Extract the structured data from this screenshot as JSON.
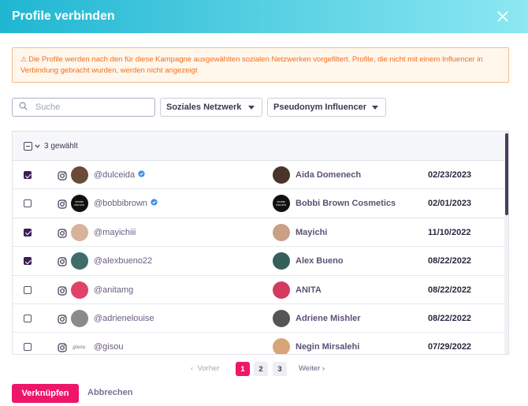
{
  "dialog": {
    "title": "Profile verbinden",
    "close_icon": "close-icon"
  },
  "alert": {
    "icon": "warning-icon",
    "text": "Die Profile werden nach den für diese Kampagne ausgewählten sozialen Netzwerken vorgefiltert. Profile, die nicht mit einem Influencer in Verbindung gebracht wurden, werden nicht angezeigt"
  },
  "filters": {
    "search_placeholder": "Suche",
    "search_value": "",
    "network_label": "Soziales Netzwerk",
    "pseudonym_label": "Pseudonym Influencer"
  },
  "table": {
    "selected_count_label": "3 gewählt",
    "rows": [
      {
        "checked": true,
        "platform": "instagram-icon",
        "handle": "@dulceida",
        "verified": true,
        "influencer": "Aida Domenech",
        "date": "02/23/2023",
        "avatar_color": "#6b4a3a",
        "influencer_avatar_color": "#4a3328"
      },
      {
        "checked": false,
        "platform": "instagram-icon",
        "handle": "@bobbibrown",
        "verified": true,
        "influencer": "Bobbi Brown Cosmetics",
        "date": "02/01/2023",
        "avatar_color": "#111111",
        "influencer_avatar_color": "#111111",
        "logo_text": "BOBBI BROWN"
      },
      {
        "checked": true,
        "platform": "instagram-icon",
        "handle": "@mayichiii",
        "verified": false,
        "influencer": "Mayichi",
        "date": "11/10/2022",
        "avatar_color": "#d7b39b",
        "influencer_avatar_color": "#c99f86"
      },
      {
        "checked": true,
        "platform": "instagram-icon",
        "handle": "@alexbueno22",
        "verified": false,
        "influencer": "Alex Bueno",
        "date": "08/22/2022",
        "avatar_color": "#3e6d6a",
        "influencer_avatar_color": "#365f5c"
      },
      {
        "checked": false,
        "platform": "instagram-icon",
        "handle": "@anitamg",
        "verified": false,
        "influencer": "ANITA",
        "date": "08/22/2022",
        "avatar_color": "#e0426a",
        "influencer_avatar_color": "#d43a60"
      },
      {
        "checked": false,
        "platform": "instagram-icon",
        "handle": "@adrienelouise",
        "verified": false,
        "influencer": "Adriene Mishler",
        "date": "08/22/2022",
        "avatar_color": "#8a8a8a",
        "influencer_avatar_color": "#555555"
      },
      {
        "checked": false,
        "platform": "instagram-icon",
        "handle": "@gisou",
        "verified": false,
        "influencer": "Negin Mirsalehi",
        "date": "07/29/2022",
        "avatar_color": "#ffffff",
        "influencer_avatar_color": "#d8a577",
        "logo_text": "gisou"
      }
    ]
  },
  "pagination": {
    "prev_label": "Vorher",
    "next_label": "Weiter",
    "pages": [
      "1",
      "2",
      "3"
    ],
    "current": "1"
  },
  "actions": {
    "connect_label": "Verknüpfen",
    "cancel_label": "Abbrechen"
  },
  "colors": {
    "accent": "#ee1668",
    "header_gradient_start": "#1fb6d2",
    "header_gradient_end": "#8ce8f2",
    "checkbox_checked": "#3b1f55",
    "verified_badge": "#3c8ee8",
    "alert_text": "#f0701e"
  }
}
